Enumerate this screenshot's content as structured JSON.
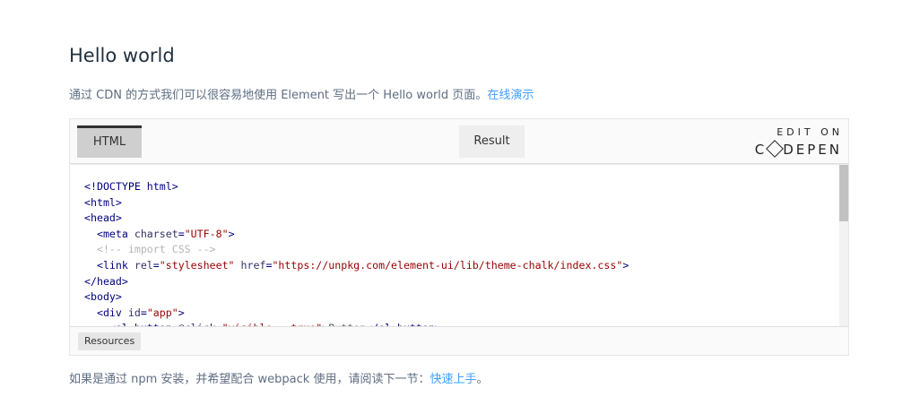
{
  "section": {
    "title": "Hello world",
    "intro_text": "通过 CDN 的方式我们可以很容易地使用 Element 写出一个 Hello world 页面。",
    "intro_link": "在线演示"
  },
  "embed": {
    "tabs": {
      "html": "HTML",
      "result": "Result"
    },
    "codepen": {
      "edit_on": "EDIT ON",
      "brand_prefix": "C",
      "brand_suffix": "DEPEN"
    },
    "code_lines": [
      {
        "t1": "<!DOCTYPE html>"
      },
      {
        "t1": "<html>"
      },
      {
        "t1": "<head>"
      },
      {
        "t1": "  <meta ",
        "a1": "charset",
        "e1": "=",
        "s1": "\"UTF-8\"",
        "t2": ">"
      },
      {
        "c1": "  <!-- import CSS -->"
      },
      {
        "t1": "  <link ",
        "a1": "rel",
        "e1": "=",
        "s1": "\"stylesheet\"",
        "a2": " href",
        "e2": "=",
        "s2": "\"https://unpkg.com/element-ui/lib/theme-chalk/index.css\"",
        "t2": ">"
      },
      {
        "t1": "</head>"
      },
      {
        "t1": "<body>"
      },
      {
        "t1": "  <div ",
        "a1": "id",
        "e1": "=",
        "s1": "\"app\"",
        "t2": ">"
      },
      {
        "t1": "    <el-button ",
        "a1": "@click",
        "e1": "=",
        "s1": "\"visible = true\"",
        "t2": ">",
        "x1": "Button",
        "t3": "</el-button>"
      }
    ],
    "resources_label": "Resources"
  },
  "footer": {
    "text": "如果是通过 npm 安装，并希望配合 webpack 使用，请阅读下一节：",
    "link": "快速上手",
    "end": "。"
  }
}
